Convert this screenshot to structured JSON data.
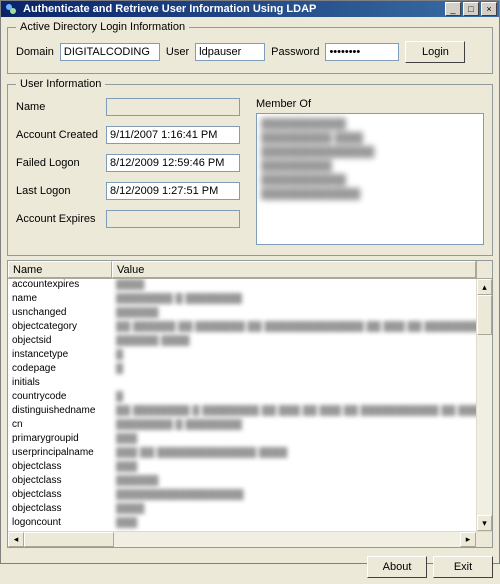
{
  "window": {
    "title": "Authenticate and Retrieve User Information Using LDAP",
    "min": "_",
    "max": "□",
    "close": "×"
  },
  "login": {
    "legend": "Active Directory Login Information",
    "domain_label": "Domain",
    "domain_value": "DIGITALCODING",
    "user_label": "User",
    "user_value": "ldpauser",
    "password_label": "Password",
    "password_value": "********",
    "login_btn": "Login"
  },
  "userinfo": {
    "legend": "User Information",
    "name_label": "Name",
    "name_value": " ",
    "created_label": "Account Created",
    "created_value": "9/11/2007 1:16:41 PM",
    "failed_label": "Failed Logon",
    "failed_value": "8/12/2009 12:59:46 PM",
    "last_label": "Last Logon",
    "last_value": "8/12/2009 1:27:51 PM",
    "expires_label": "Account Expires",
    "expires_value": "",
    "memberof_label": "Member Of"
  },
  "grid": {
    "hdr_name": "Name",
    "hdr_value": "Value",
    "rows": [
      {
        "name": "accountexpires",
        "value": "████"
      },
      {
        "name": "name",
        "value": "████████ █ ████████"
      },
      {
        "name": "usnchanged",
        "value": "██████"
      },
      {
        "name": "objectcategory",
        "value": "██ ██████ ██ ███████ ██ ██████████████ ██ ███ ██ ████████████ ██ ████"
      },
      {
        "name": "objectsid",
        "value": "██████ ████"
      },
      {
        "name": "instancetype",
        "value": "█"
      },
      {
        "name": "codepage",
        "value": "█"
      },
      {
        "name": "initials",
        "value": ""
      },
      {
        "name": "countrycode",
        "value": "█"
      },
      {
        "name": "distinguishedname",
        "value": "██ ████████ █ ████████ ██  ███ ██ ███ ██ ███████████ ██ ████"
      },
      {
        "name": "cn",
        "value": "████████ █ ████████"
      },
      {
        "name": "primarygroupid",
        "value": "███"
      },
      {
        "name": "userprincipalname",
        "value": "███ ██ ██████████████ ████"
      },
      {
        "name": "objectclass",
        "value": "███"
      },
      {
        "name": "objectclass",
        "value": "██████"
      },
      {
        "name": "objectclass",
        "value": "██████████████████"
      },
      {
        "name": "objectclass",
        "value": "████"
      },
      {
        "name": "logoncount",
        "value": "███"
      }
    ]
  },
  "footer": {
    "about": "About",
    "exit": "Exit"
  }
}
